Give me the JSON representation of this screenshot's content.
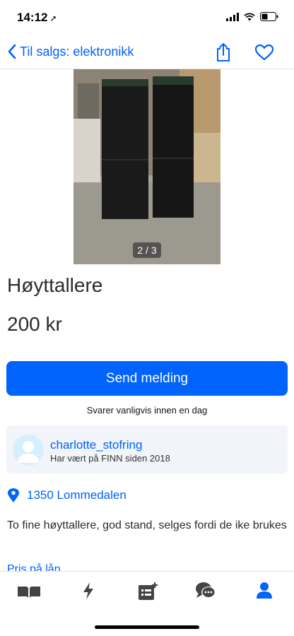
{
  "status_bar": {
    "time": "14:12",
    "location_arrow": "location-arrow-icon",
    "icons": [
      "signal-bars-icon",
      "wifi-icon",
      "battery-icon"
    ]
  },
  "nav": {
    "back_label": "Til salgs: elektronikk",
    "back_icon": "chevron-left-icon",
    "share_icon": "share-icon",
    "favorite_icon": "heart-outline-icon"
  },
  "listing": {
    "image_counter": "2 / 3",
    "title": "Høyttallere",
    "price": "200 kr",
    "description": "To fine høyttallere, god stand, selges fordi de ike brukes",
    "loan_link": "Pris på lån"
  },
  "contact": {
    "send_button": "Send melding",
    "reply_note": "Svarer vanligvis innen en dag"
  },
  "seller": {
    "name": "charlotte_stofring",
    "since": "Har vært på FINN siden 2018"
  },
  "location": {
    "text": "1350 Lommedalen",
    "icon": "map-pin-icon"
  },
  "tab_bar": {
    "items": [
      {
        "icon": "book-icon",
        "active": false
      },
      {
        "icon": "lightning-icon",
        "active": false
      },
      {
        "icon": "new-ad-icon",
        "active": false
      },
      {
        "icon": "messages-icon",
        "active": false
      },
      {
        "icon": "profile-icon",
        "active": true
      }
    ]
  },
  "colors": {
    "accent": "#0063fb",
    "seller_box_bg": "#f1f4f9",
    "tab_inactive": "#444444",
    "tab_active": "#0063fb"
  }
}
